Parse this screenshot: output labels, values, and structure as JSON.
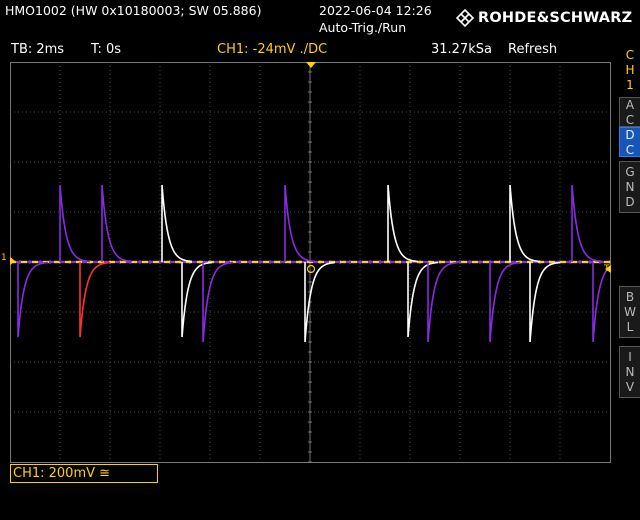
{
  "header": {
    "device_info": "HMO1002 (HW 0x10180003; SW 05.886)",
    "datetime": "2022-06-04 12:26",
    "trigger_mode": "Auto-Trig./Run",
    "brand": "ROHDE&SCHWARZ"
  },
  "status_bar": {
    "timebase": "TB: 2ms",
    "trigger_time": "T: 0s",
    "channel_trigger": "CH1: -24mV ./DC",
    "sample_rate": "31.27kSa",
    "acquisition": "Refresh"
  },
  "side_menu": {
    "channel_tab": [
      "C",
      "H",
      "1"
    ],
    "ac": [
      "A",
      "C"
    ],
    "dc": [
      "D",
      "C"
    ],
    "gnd": [
      "G",
      "N",
      "D"
    ],
    "bwl": [
      "B",
      "W",
      "L"
    ],
    "inv": [
      "I",
      "N",
      "V"
    ]
  },
  "screen": {
    "marker_left": "1",
    "marker_right": "T",
    "ch1_scale": "CH1: 200mV ≅"
  },
  "colors": {
    "trace_primary": "#ffd200",
    "trace_white": "#ffffff",
    "trace_purple": "#8a2be2",
    "trace_red": "#ff3030",
    "grid": "#606060",
    "accent_dc": "#1656b8"
  }
}
